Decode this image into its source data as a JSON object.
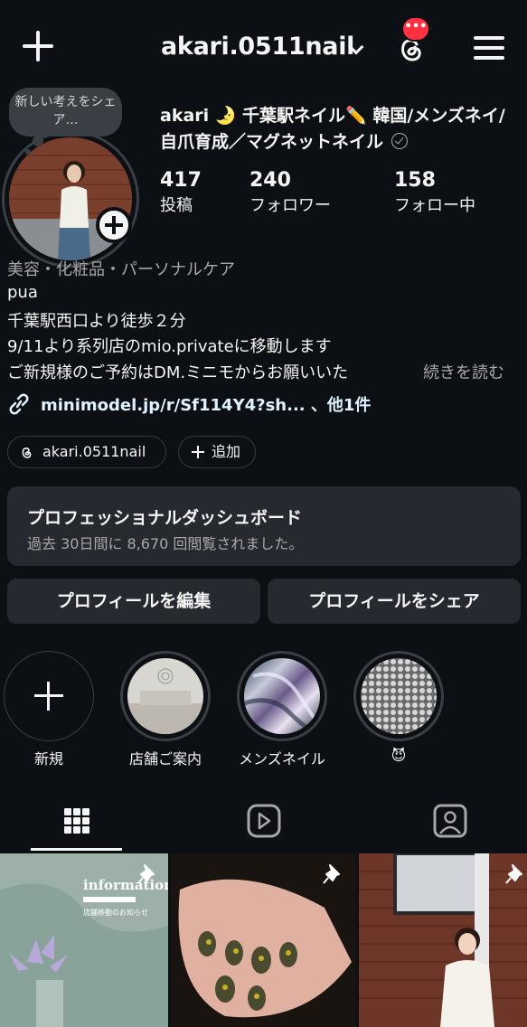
{
  "header": {
    "username": "akari.0511nail",
    "notification_badge": "•••",
    "icons": [
      "plus-icon",
      "chevron-down-icon",
      "threads-icon",
      "menu-icon"
    ]
  },
  "profile": {
    "note_bubble": "新しい考えをシェア…",
    "display_name": "akari 🌛 千葉駅ネイル✏️ 韓国/メンズネイ/自爪育成／マグネットネイル",
    "stats": [
      {
        "value": "417",
        "label": "投稿"
      },
      {
        "value": "240",
        "label": "フォロワー"
      },
      {
        "value": "158",
        "label": "フォロー中"
      }
    ],
    "category": "美容・化粧品・パーソナルケア",
    "bio_lines": [
      "pua",
      "千葉駅西口より徒歩２分",
      "9/11より系列店のmio.privateに移動します",
      "ご新規様のご予約はDM.ミニモからお願いいた"
    ],
    "more_label": "続きを読む",
    "link_text": "minimodel.jp/r/Sf114Y4?sh... 、他1件",
    "threads_chip": "akari.0511nail",
    "add_chip": "追加"
  },
  "dashboard": {
    "title": "プロフェッショナルダッシュボード",
    "subtitle": "過去 30日間に 8,670 回閲覧されました。"
  },
  "buttons": {
    "edit_profile": "プロフィールを編集",
    "share_profile": "プロフィールをシェア"
  },
  "highlights": [
    {
      "label": "新規"
    },
    {
      "label": "店舗ご案内"
    },
    {
      "label": "メンズネイル"
    },
    {
      "label": "😈"
    }
  ],
  "tabs": [
    "grid-icon",
    "reels-icon",
    "tagged-icon"
  ],
  "grid_posts": [
    {
      "overlay_title": "information",
      "overlay_sub": "店舗移動のお知らせ",
      "pinned": true
    },
    {
      "pinned": true
    },
    {
      "pinned": true
    }
  ],
  "colors": {
    "background": "#0c1014",
    "card": "#262a30",
    "badge": "#ff3040",
    "muted_text": "#a8a8a8"
  }
}
